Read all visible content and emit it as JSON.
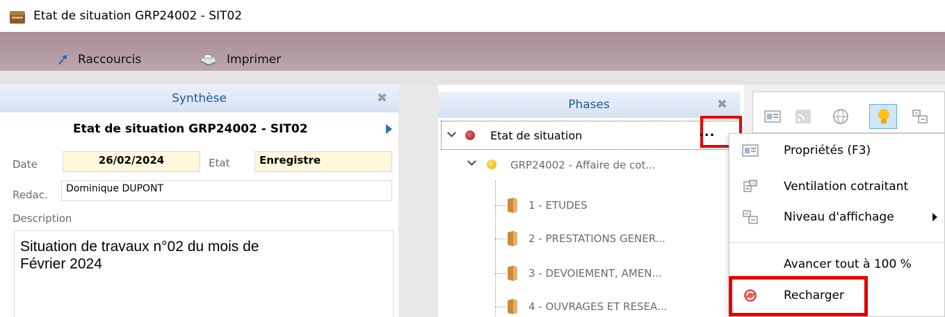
{
  "window": {
    "title": "Etat de situation GRP24002 - SIT02"
  },
  "toolbar": {
    "shortcuts_label": "Raccourcis",
    "print_label": "Imprimer"
  },
  "synthese": {
    "header": "Synthèse",
    "doc_title": "Etat de situation GRP24002 - SIT02",
    "date_label": "Date",
    "date_value": "26/02/2024",
    "etat_label": "Etat",
    "etat_value": "Enregistre",
    "redac_label": "Redac.",
    "redac_value": "Dominique DUPONT",
    "description_label": "Description",
    "description_value": "Situation de travaux n°02 du mois de\nFévrier 2024"
  },
  "phases": {
    "header": "Phases",
    "root_label": "Etat de situation",
    "more_label": "...",
    "child_label": "GRP24002 - Affaire de cot...",
    "items": [
      {
        "label": "1 - ETUDES"
      },
      {
        "label": "2 - PRESTATIONS GENER..."
      },
      {
        "label": "3 - DEVOIEMENT, AMEN..."
      },
      {
        "label": "4 - OUVRAGES ET RESEA..."
      }
    ]
  },
  "context_menu": {
    "properties": "Propriétés (F3)",
    "ventilation": "Ventilation cotraitant",
    "niveau": "Niveau d'affichage",
    "avancer": "Avancer tout à 100 %",
    "recharger": "Recharger"
  },
  "colors": {
    "highlight": "#e60000",
    "header_text": "#1d5a9e",
    "toolbar": "#b49ba4",
    "field_yellow": "#fff8dc"
  }
}
